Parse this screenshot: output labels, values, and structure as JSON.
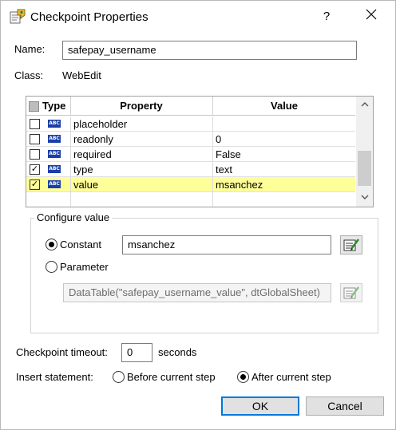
{
  "window": {
    "title": "Checkpoint Properties",
    "help_label": "?",
    "close_label": "✕"
  },
  "fields": {
    "name_label": "Name:",
    "name_value": "safepay_username",
    "class_label": "Class:",
    "class_value": "WebEdit"
  },
  "grid": {
    "headers": {
      "type": "Type",
      "property": "Property",
      "value": "Value"
    },
    "type_badge": "ABC",
    "rows": [
      {
        "property": "placeholder",
        "value": "",
        "checked": false,
        "selected": false
      },
      {
        "property": "readonly",
        "value": "0",
        "checked": false,
        "selected": false
      },
      {
        "property": "required",
        "value": "False",
        "checked": false,
        "selected": false
      },
      {
        "property": "type",
        "value": "text",
        "checked": true,
        "selected": false
      },
      {
        "property": "value",
        "value": "msanchez",
        "checked": true,
        "selected": true
      }
    ],
    "check_glyph": "✓",
    "highlight_color": "#ffff99"
  },
  "configure": {
    "group_title": "Configure value",
    "constant_label": "Constant",
    "constant_value": "msanchez",
    "parameter_label": "Parameter",
    "parameter_value": "DataTable(\"safepay_username_value\", dtGlobalSheet)",
    "selected_option": "Constant"
  },
  "timeout": {
    "label": "Checkpoint timeout:",
    "value": "0",
    "unit": "seconds"
  },
  "insert": {
    "label": "Insert statement:",
    "before_label": "Before current step",
    "after_label": "After current step",
    "selected_option": "After current step"
  },
  "buttons": {
    "ok_label": "OK",
    "cancel_label": "Cancel"
  },
  "colors": {
    "accent": "#0078d7",
    "type_badge": "#1a3fa8"
  }
}
